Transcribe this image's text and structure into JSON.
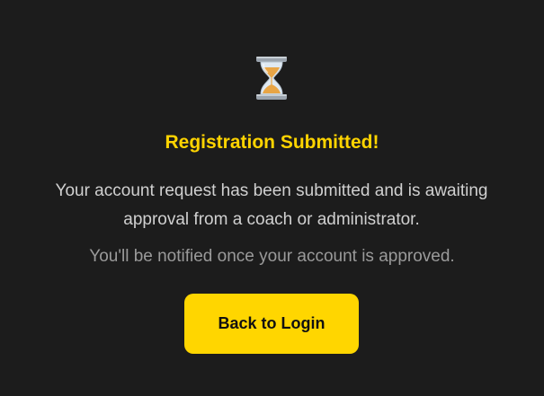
{
  "status": {
    "icon": "hourglass-icon",
    "title": "Registration Submitted!",
    "message": "Your account request has been submitted and is awaiting approval from a coach or administrator.",
    "note": "You'll be notified once your account is approved."
  },
  "actions": {
    "back_label": "Back to Login"
  },
  "colors": {
    "background": "#1c1c1c",
    "accent": "#ffd600",
    "title": "#ffd400",
    "body_text": "#d0d0d0",
    "muted_text": "#9a9a9a"
  }
}
